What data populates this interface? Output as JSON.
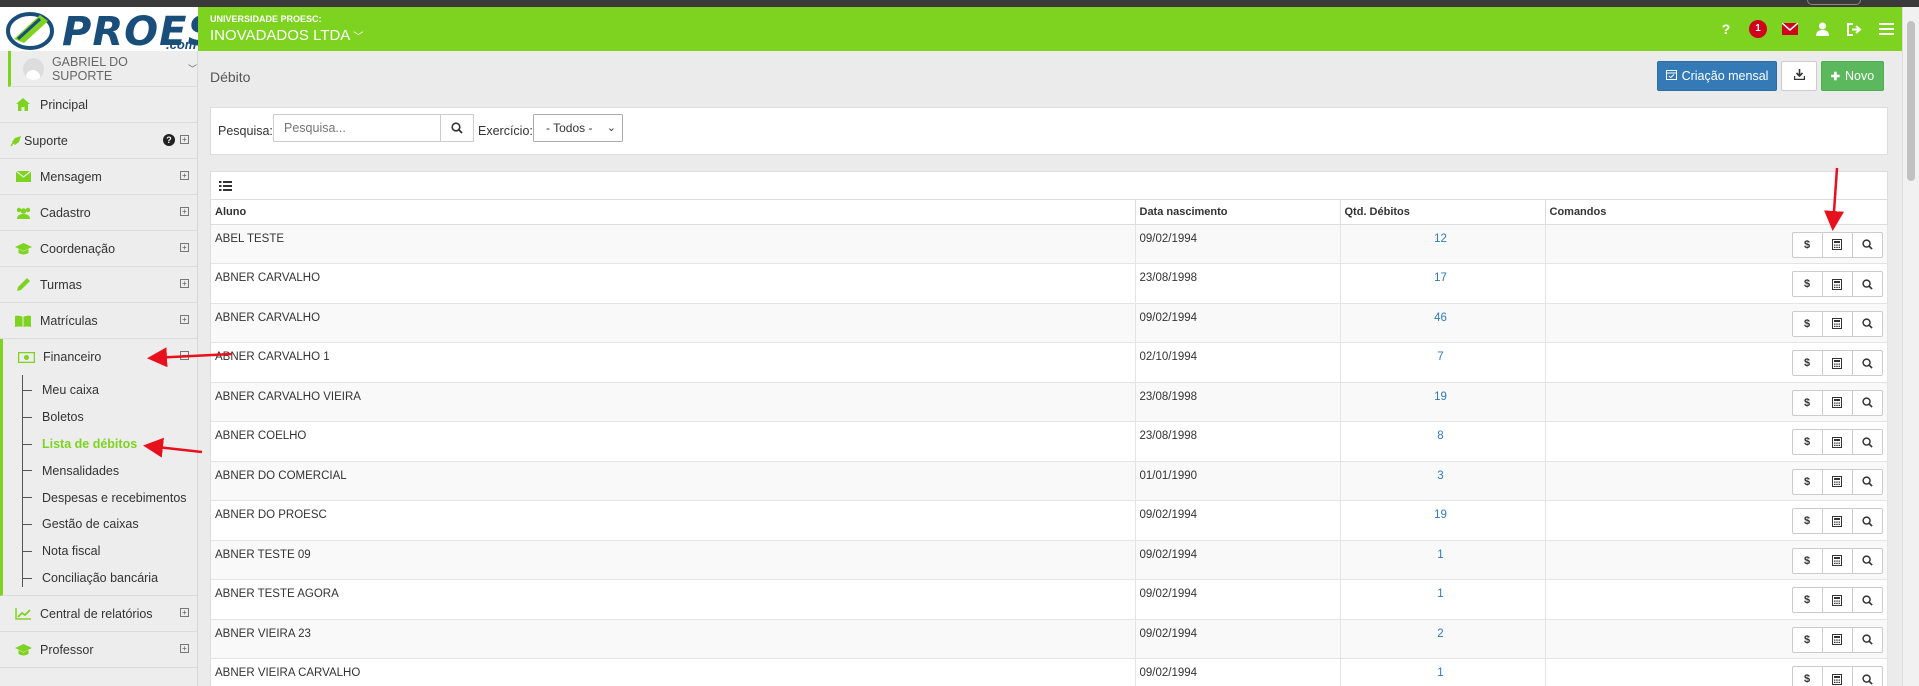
{
  "app": {
    "logo_text": "PROESC",
    "logo_suffix": ".com",
    "org_subtitle": "UNIVERSIDADE PROESC:",
    "org_name": "INOVADADOS LTDA",
    "notification_count": "1",
    "accent_color": "#7ed321",
    "header_icons": [
      "help-icon",
      "notification-badge",
      "mail-icon",
      "user-icon",
      "logout-icon",
      "hamburger-menu-icon"
    ]
  },
  "sidebar": {
    "user_name": "GABRIEL DO SUPORTE",
    "items": [
      {
        "label": "Principal",
        "icon": "home-icon"
      },
      {
        "label": "Suporte",
        "icon": "rocket-icon"
      },
      {
        "label": "Mensagem",
        "icon": "envelope-icon"
      },
      {
        "label": "Cadastro",
        "icon": "users-icon"
      },
      {
        "label": "Coordenação",
        "icon": "graduation-cap-icon"
      },
      {
        "label": "Turmas",
        "icon": "pencil-icon"
      },
      {
        "label": "Matrículas",
        "icon": "book-icon"
      },
      {
        "label": "Financeiro",
        "icon": "money-icon"
      }
    ],
    "financeiro_sub": [
      "Meu caixa",
      "Boletos",
      "Lista de débitos",
      "Mensalidades",
      "Despesas e recebimentos",
      "Gestão de caixas",
      "Nota fiscal",
      "Conciliação bancária"
    ],
    "bottom_items": [
      {
        "label": "Central de relatórios",
        "icon": "chart-line-icon"
      },
      {
        "label": "Professor",
        "icon": "graduation-cap-icon"
      }
    ]
  },
  "main": {
    "title": "Débito",
    "buttons": {
      "mensal": "Criação mensal",
      "novo": "Novo"
    },
    "search": {
      "label": "Pesquisa:",
      "placeholder": "Pesquisa...",
      "exercicio_label": "Exercício:",
      "exercicio_value": "- Todos -"
    },
    "table": {
      "headers": [
        "Aluno",
        "Data nascimento",
        "Qtd. Débitos",
        "Comandos"
      ],
      "rows": [
        {
          "aluno": "ABEL TESTE",
          "nascimento": "09/02/1994",
          "qtd": "12"
        },
        {
          "aluno": "ABNER CARVALHO",
          "nascimento": "23/08/1998",
          "qtd": "17"
        },
        {
          "aluno": "ABNER CARVALHO",
          "nascimento": "09/02/1994",
          "qtd": "46"
        },
        {
          "aluno": "ABNER CARVALHO 1",
          "nascimento": "02/10/1994",
          "qtd": "7"
        },
        {
          "aluno": "ABNER CARVALHO VIEIRA",
          "nascimento": "23/08/1998",
          "qtd": "19"
        },
        {
          "aluno": "ABNER COELHO",
          "nascimento": "23/08/1998",
          "qtd": "8"
        },
        {
          "aluno": "ABNER DO COMERCIAL",
          "nascimento": "01/01/1990",
          "qtd": "3"
        },
        {
          "aluno": "ABNER DO PROESC",
          "nascimento": "09/02/1994",
          "qtd": "19"
        },
        {
          "aluno": "ABNER TESTE 09",
          "nascimento": "09/02/1994",
          "qtd": "1"
        },
        {
          "aluno": "ABNER TESTE AGORA",
          "nascimento": "09/02/1994",
          "qtd": "1"
        },
        {
          "aluno": "ABNER VIEIRA 23",
          "nascimento": "09/02/1994",
          "qtd": "2"
        },
        {
          "aluno": "ABNER VIEIRA CARVALHO",
          "nascimento": "09/02/1994",
          "qtd": "1"
        }
      ],
      "command_icons": [
        "dollar-icon",
        "calculator-icon",
        "search-icon"
      ],
      "dollar_glyph": "$"
    }
  },
  "annotation_color": "#e8101c"
}
